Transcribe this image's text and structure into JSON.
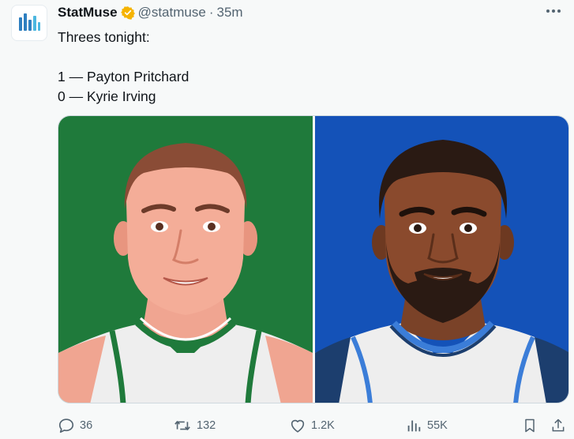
{
  "tweet": {
    "author": {
      "display_name": "StatMuse",
      "handle": "@statmuse",
      "verified_icon": "verified-badge-gold",
      "avatar_icon": "statmuse-logo"
    },
    "separator": "·",
    "time": "35m",
    "text_lines": [
      "Threes tonight:",
      "",
      "1 — Payton Pritchard",
      "0 — Kyrie Irving"
    ],
    "media": {
      "images": [
        {
          "subject": "Payton Pritchard illustration",
          "background": "#1f7a3b",
          "icon": "player-illustration"
        },
        {
          "subject": "Kyrie Irving illustration",
          "background": "#1452b8",
          "icon": "player-illustration"
        }
      ]
    },
    "actions": {
      "replies": {
        "icon": "reply-icon",
        "count": "36"
      },
      "reposts": {
        "icon": "repost-icon",
        "count": "132"
      },
      "likes": {
        "icon": "like-icon",
        "count": "1.2K"
      },
      "views": {
        "icon": "views-icon",
        "count": "55K"
      },
      "bookmark": {
        "icon": "bookmark-icon"
      },
      "share": {
        "icon": "share-icon"
      }
    }
  },
  "colors": {
    "accent_verified": "#f5b301",
    "text_primary": "#0f1419",
    "text_secondary": "#536471",
    "celtics_green": "#1f7a3b",
    "mavs_blue": "#1452b8"
  }
}
